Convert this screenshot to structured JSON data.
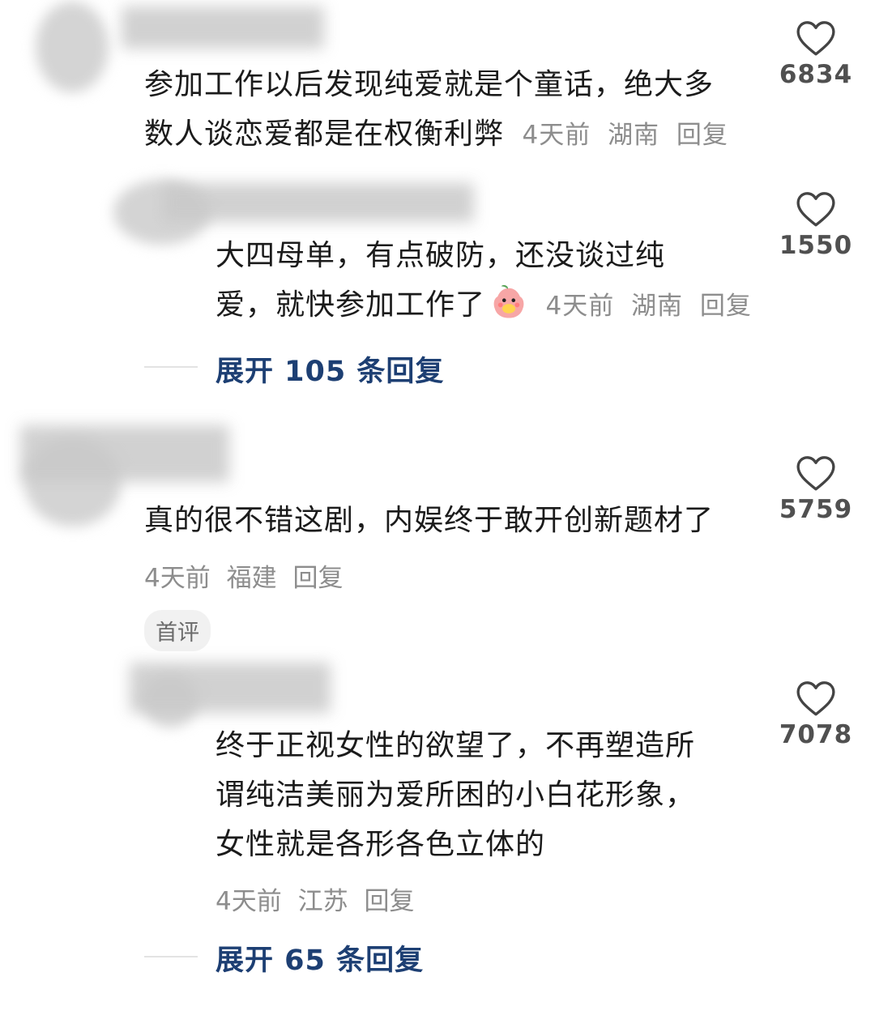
{
  "comments": [
    {
      "text_line1": "参加工作以后发现纯爱就是个童话，绝大多",
      "text_line2": "数人谈恋爱都是在权衡利弊",
      "time": "4天前",
      "location": "湖南",
      "reply_label": "回复",
      "likes": "6834"
    },
    {
      "text_line1": "大四母单，有点破防，还没谈过纯",
      "text_line2": "爱，就快参加工作了",
      "emoji": "peach-face-emoji",
      "time": "4天前",
      "location": "湖南",
      "reply_label": "回复",
      "likes": "1550"
    },
    {
      "text_line1": "真的很不错这剧，内娱终于敢开创新题材了",
      "time": "4天前",
      "location": "福建",
      "reply_label": "回复",
      "likes": "5759",
      "badge": "首评"
    },
    {
      "text_line1": "终于正视女性的欲望了，不再塑造所",
      "text_line2": "谓纯洁美丽为爱所困的小白花形象，",
      "text_line3": "女性就是各形各色立体的",
      "time": "4天前",
      "location": "江苏",
      "reply_label": "回复",
      "likes": "7078"
    }
  ],
  "expand_1": "展开 105 条回复",
  "expand_2": "展开 65 条回复",
  "icons": {
    "like": "heart-outline-icon"
  },
  "colors": {
    "expand_link": "#1d3f73",
    "meta": "#8d8d8d",
    "like_count": "#505050"
  }
}
